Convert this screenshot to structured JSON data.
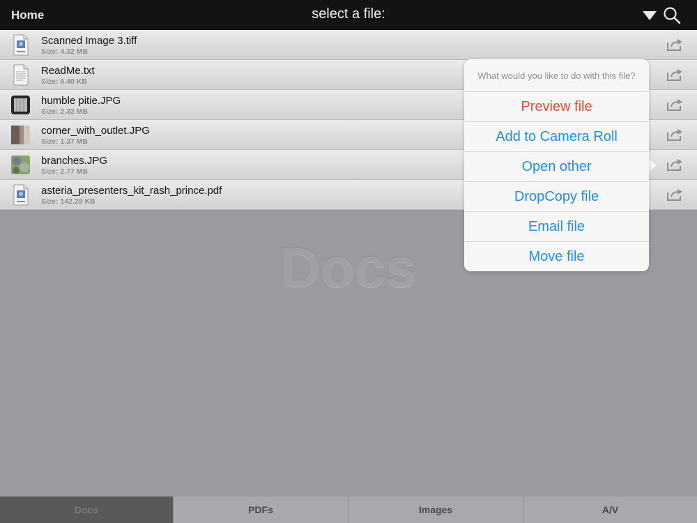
{
  "header": {
    "home_label": "Home",
    "title": "select a file:"
  },
  "files": [
    {
      "name": "Scanned Image 3.tiff",
      "size": "Size: 4.32 MB",
      "icon": "jpeg-document-icon"
    },
    {
      "name": "ReadMe.txt",
      "size": "Size: 0.40 KB",
      "icon": "text-document-icon"
    },
    {
      "name": "humble pitie.JPG",
      "size": "Size: 2.32 MB",
      "icon": "image-thumbnail"
    },
    {
      "name": "corner_with_outlet.JPG",
      "size": "Size: 1.37 MB",
      "icon": "image-thumbnail"
    },
    {
      "name": "branches.JPG",
      "size": "Size: 2.77 MB",
      "icon": "image-thumbnail"
    },
    {
      "name": "asteria_presenters_kit_rash_prince.pdf",
      "size": "Size: 142.29 KB",
      "icon": "jpeg-document-icon"
    }
  ],
  "watermark": "Docs",
  "popover": {
    "prompt": "What would you like to do with this file?",
    "actions": [
      "Preview file",
      "Add to Camera Roll",
      "Open other",
      "DropCopy file",
      "Email file",
      "Move file"
    ]
  },
  "tabs": [
    "Docs",
    "PDFs",
    "Images",
    "A/V"
  ],
  "colors": {
    "accent": "#1f8df2",
    "destructive": "#ef4a32",
    "topbar": "#131313",
    "background": "#9a9b9f"
  }
}
